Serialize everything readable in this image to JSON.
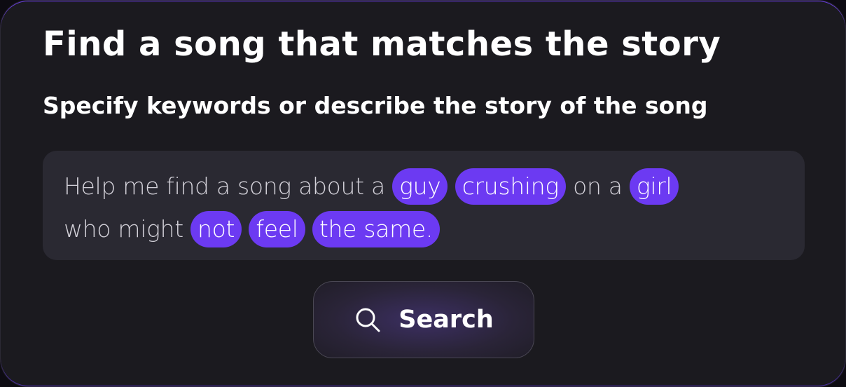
{
  "header": {
    "title": "Find a song that matches the story",
    "subtitle": "Specify keywords or describe the story of the song"
  },
  "query": {
    "line1": {
      "t1": "Help me find a song about a ",
      "k1": "guy",
      "t2": " ",
      "k2": "crushing",
      "t3": " on a ",
      "k3": "girl"
    },
    "line2": {
      "t1": "who might ",
      "k1": "not",
      "t2": " ",
      "k2": "feel",
      "t3": " ",
      "k3": "the same."
    }
  },
  "search": {
    "label": "Search",
    "icon": "search-icon"
  },
  "colors": {
    "accent": "#6c3af2",
    "card_background": "#1b1a1f",
    "input_background": "#2a2932"
  }
}
